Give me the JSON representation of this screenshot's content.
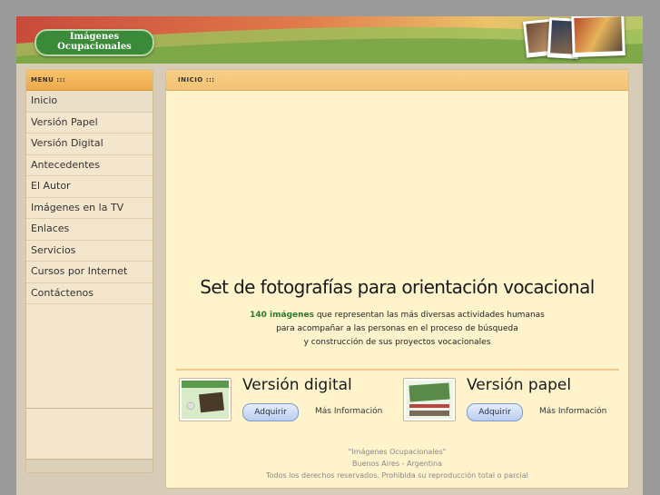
{
  "site": {
    "logo_text": "Imágenes\nOcupacionales"
  },
  "sidebar": {
    "header": "MENU :::",
    "items": [
      {
        "label": "Inicio"
      },
      {
        "label": "Versión Papel"
      },
      {
        "label": "Versión Digital"
      },
      {
        "label": "Antecedentes"
      },
      {
        "label": "El Autor"
      },
      {
        "label": "Imágenes en la TV"
      },
      {
        "label": "Enlaces"
      },
      {
        "label": "Servicios"
      },
      {
        "label": "Cursos por Internet"
      },
      {
        "label": "Contáctenos"
      }
    ]
  },
  "content": {
    "header": "INICIO :::",
    "title": "Set de fotografías para orientación vocacional",
    "desc_highlight": "140 imágenes",
    "desc_line1_rest": " que representan las más diversas actividades humanas",
    "desc_line2": "para acompañar a las personas en el proceso de búsqueda",
    "desc_line3": "y construcción de sus proyectos vocacionales",
    "products": [
      {
        "title": "Versión digital",
        "buy": "Adquirir",
        "more": "Más Información"
      },
      {
        "title": "Versión papel",
        "buy": "Adquirir",
        "more": "Más Información"
      }
    ],
    "footer": {
      "line1": "\"Imágenes Ocupacionales\"",
      "line2": "Buenos Aires - Argentina",
      "line3": "Todos los derechos reservados. Prohibida su reproducción total o parcial"
    }
  },
  "colors": {
    "accent_orange": "#eeaa4c",
    "logo_green": "#3a8a3a",
    "content_bg": "#fff3cc",
    "highlight_green": "#2c7a2c"
  }
}
